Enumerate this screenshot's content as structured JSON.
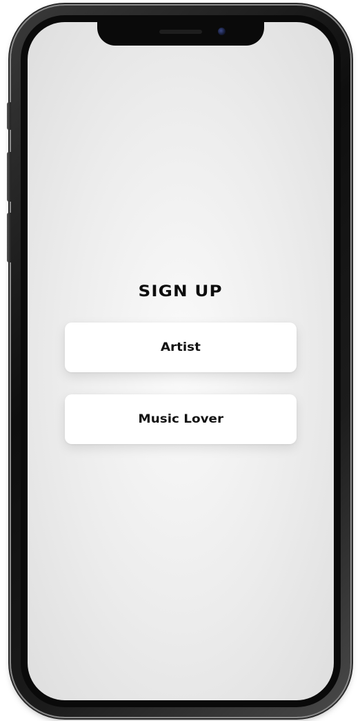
{
  "screen": {
    "title": "SIGN UP",
    "options": [
      {
        "label": "Artist"
      },
      {
        "label": "Music Lover"
      }
    ]
  },
  "colors": {
    "background": "#ececec",
    "button": "#ffffff",
    "text": "#0d0d0d"
  }
}
